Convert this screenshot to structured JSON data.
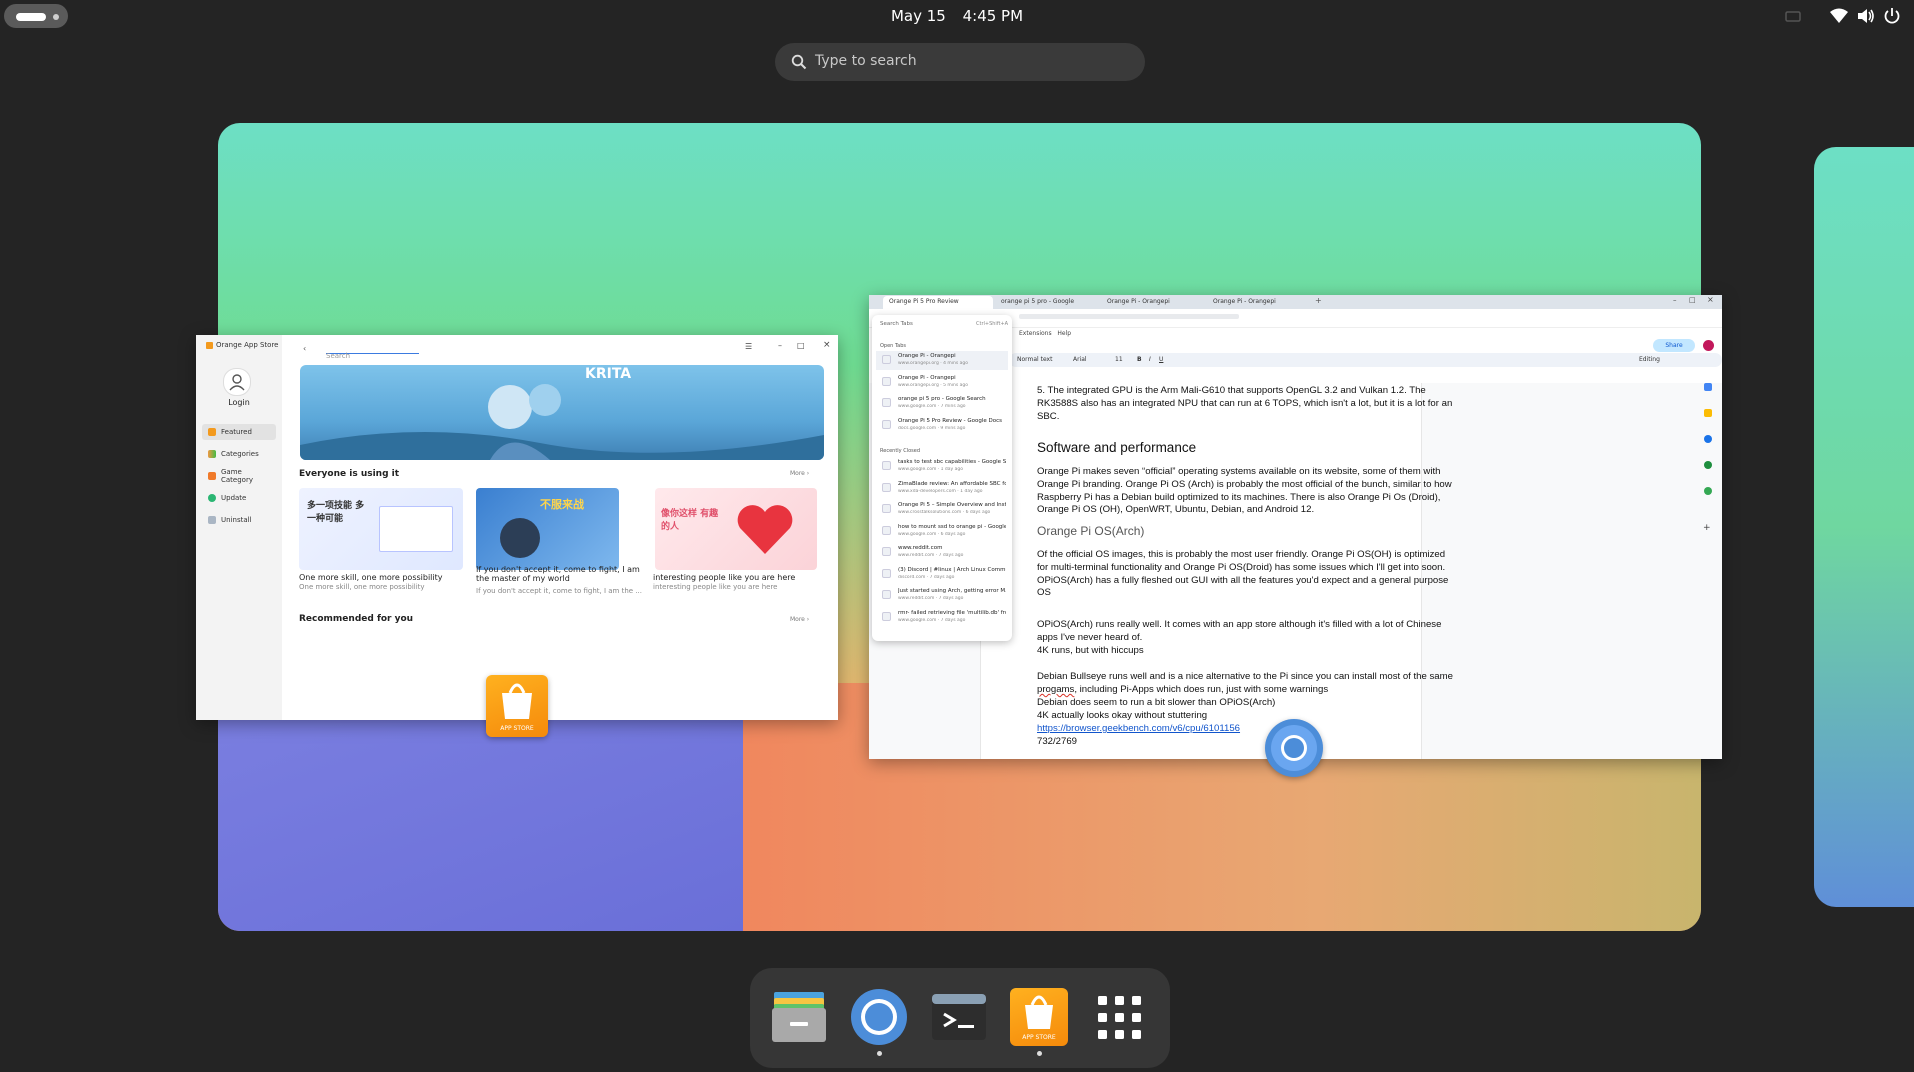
{
  "topbar": {
    "date": "May 15",
    "time": "4:45 PM"
  },
  "search": {
    "placeholder": "Type to search"
  },
  "appstore": {
    "title": "Orange App Store",
    "search_placeholder": "Search",
    "login": "Login",
    "nav": [
      "Featured",
      "Categories",
      "Game Category",
      "Update",
      "Uninstall"
    ],
    "banner_app": "KRITA",
    "section1": "Everyone is using it",
    "more": "More",
    "cards": [
      {
        "title": "One more skill, one more possibility",
        "sub": "One more skill, one more possibility",
        "art": "多一项技能 多一种可能"
      },
      {
        "title": "If you don't accept it, come to fight, I am the master of my world",
        "sub": "If you don't accept it, come to fight, I am the ...",
        "art": "不服来战"
      },
      {
        "title": "interesting people like you are here",
        "sub": "interesting people like you are here",
        "art": "像你这样 有趣的人"
      }
    ],
    "section2": "Recommended for you",
    "dock_label": "APP STORE"
  },
  "docs": {
    "tabs": [
      "Orange Pi 5 Pro Review",
      "orange pi 5 pro - Google",
      "Orange Pi - Orangepi",
      "Orange Pi - Orangepi"
    ],
    "menu": [
      "Extensions",
      "Help"
    ],
    "toolbar": {
      "style": "Normal text",
      "font": "Arial",
      "size": "11",
      "mode": "Editing",
      "share": "Share"
    },
    "tabsearch": {
      "placeholder": "Search Tabs",
      "shortcut": "Ctrl+Shift+A",
      "open_label": "Open Tabs",
      "open": [
        {
          "t": "Orange Pi - Orangepi",
          "u": "www.orangepi.org · 4 mins ago"
        },
        {
          "t": "Orange Pi - Orangepi",
          "u": "www.orangepi.org · 5 mins ago"
        },
        {
          "t": "orange pi 5 pro - Google Search",
          "u": "www.google.com · 7 mins ago"
        },
        {
          "t": "Orange Pi 5 Pro Review - Google Docs",
          "u": "docs.google.com · 9 mins ago"
        }
      ],
      "recent_label": "Recently Closed",
      "recent": [
        {
          "t": "tasks to test sbc capabilities - Google S...",
          "u": "www.google.com · 1 day ago"
        },
        {
          "t": "ZimaBlade review: An affordable SBC fo...",
          "u": "www.xda-developers.com · 1 day ago"
        },
        {
          "t": "Orange Pi 5 – Simple Overview and Inst...",
          "u": "www.crosstalksolutions.com · 6 days ago"
        },
        {
          "t": "how to mount ssd to orange pi - Google ...",
          "u": "www.google.com · 6 days ago"
        },
        {
          "t": "www.reddit.com",
          "u": "www.reddit.com · 7 days ago"
        },
        {
          "t": "(3) Discord | #linux | Arch Linux Commu...",
          "u": "discord.com · 7 days ago"
        },
        {
          "t": "Just started using Arch, getting error M...",
          "u": "www.reddit.com · 7 days ago"
        },
        {
          "t": "rmr- failed retrieving file 'multilib.db' fro...",
          "u": "www.google.com · 7 days ago"
        }
      ]
    },
    "content": {
      "p_top": "5. The integrated GPU is the Arm Mali-G610 that supports OpenGL 3.2 and Vulkan 1.2. The RK3588S also has an integrated NPU that can run at 6 TOPS, which isn't a lot, but it is a lot for an SBC.",
      "h1": "Software and performance",
      "p1": "Orange Pi makes seven “official” operating systems available on its website, some of them with Orange Pi branding. Orange Pi OS (Arch) is probably the most official of the bunch, similar to how Raspberry Pi has a Debian build optimized to its machines. There is also Orange Pi Os (Droid), Orange Pi OS (OH), OpenWRT, Ubuntu, Debian, and Android 12.",
      "h2": "Orange Pi OS(Arch)",
      "p2": "Of the official OS images, this is probably the most user friendly. Orange Pi OS(OH) is optimized for multi-terminal functionality and Orange Pi OS(Droid) has some issues which I'll get into soon. OPiOS(Arch) has a fully fleshed out GUI with all the features you'd expect and a general purpose OS",
      "p3a": "OPiOS(Arch) runs really well. It comes with an app store although it's filled with a lot of Chinese apps I've never heard of.",
      "p3b": "4K runs, but with hiccups",
      "p4a_pre": "Debian Bullseye runs well and is a nice alternative to the Pi since you can install most of the same ",
      "p4a_err": "progams",
      "p4a_post": ", including Pi-Apps which does run, just with some warnings",
      "p4b": "Debian does seem to run a bit slower than OPiOS(Arch)",
      "p4c": "4K actually looks okay without stuttering",
      "link": "https://browser.geekbench.com/v6/cpu/6101156",
      "score": "732/2769"
    }
  },
  "dock": {
    "apps": [
      "files-icon",
      "chrome-icon",
      "terminal-icon",
      "app-store-icon",
      "show-apps-icon"
    ],
    "appstore_label": "APP STORE"
  },
  "colors": {
    "accent": "#4c8dd9",
    "dock_bg": "#363636",
    "topbar_bg": "#242424"
  }
}
